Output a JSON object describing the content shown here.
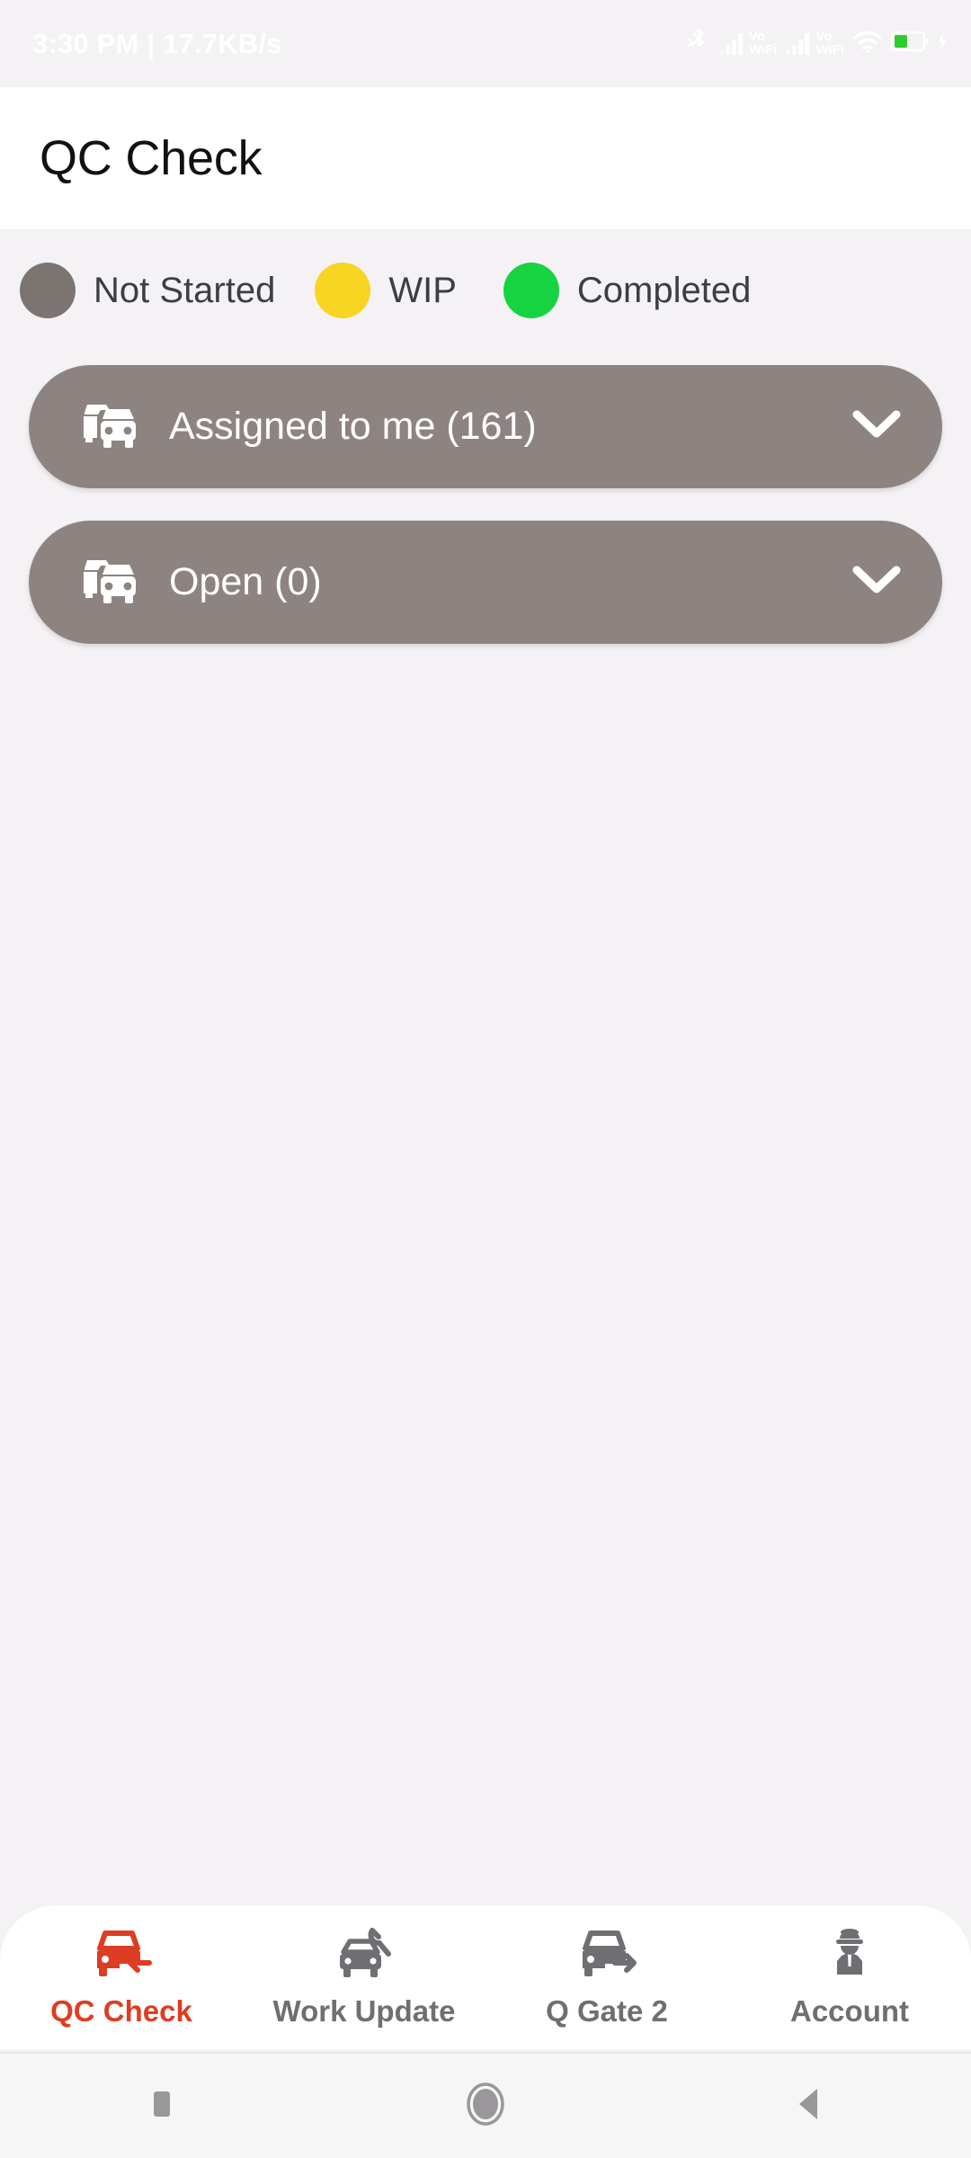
{
  "status_bar": {
    "time_and_speed": "3:30 PM | 17.7KB/s",
    "icons": [
      {
        "name": "bluetooth-icon"
      },
      {
        "name": "signal-bars-icon-sim1",
        "label_top": "Vo",
        "label_bottom": "WiFi"
      },
      {
        "name": "signal-bars-icon-sim2",
        "label_top": "Vo",
        "label_bottom": "WiFi"
      },
      {
        "name": "wifi-icon"
      },
      {
        "name": "battery-icon"
      },
      {
        "name": "charging-bolt-icon"
      }
    ],
    "battery_fill_color": "#2ecc2e",
    "text_color": "#ffffff",
    "background": "#f4f2f4"
  },
  "app_bar": {
    "title": "QC Check",
    "background": "#ffffff"
  },
  "legend": {
    "items": [
      {
        "label": "Not Started",
        "color": "#7c7470",
        "icon": "status-dot-not-started"
      },
      {
        "label": "WIP",
        "color": "#f8d423",
        "icon": "status-dot-wip"
      },
      {
        "label": "Completed",
        "color": "#16d441",
        "icon": "status-dot-completed"
      }
    ]
  },
  "groups": [
    {
      "label": "Assigned to me (161)",
      "count": 161,
      "icon": "cars-icon",
      "chevron": "chevron-down-icon",
      "expanded": false,
      "background": "#8d8481"
    },
    {
      "label": "Open (0)",
      "count": 0,
      "icon": "cars-icon",
      "chevron": "chevron-down-icon",
      "expanded": false,
      "background": "#8d8481"
    }
  ],
  "bottom_nav": {
    "active_color": "#dd3d23",
    "inactive_color": "#6f6f73",
    "items": [
      {
        "label": "QC Check",
        "icon": "car-arrow-left-icon",
        "active": true
      },
      {
        "label": "Work Update",
        "icon": "car-wrench-icon",
        "active": false
      },
      {
        "label": "Q Gate 2",
        "icon": "car-arrow-right-icon",
        "active": false
      },
      {
        "label": "Account",
        "icon": "driver-person-icon",
        "active": false
      }
    ]
  },
  "system_nav": {
    "buttons": [
      {
        "name": "recents-button",
        "icon": "square-icon"
      },
      {
        "name": "home-button",
        "icon": "circle-icon"
      },
      {
        "name": "back-button",
        "icon": "triangle-left-icon"
      }
    ],
    "color": "#9a979b"
  }
}
